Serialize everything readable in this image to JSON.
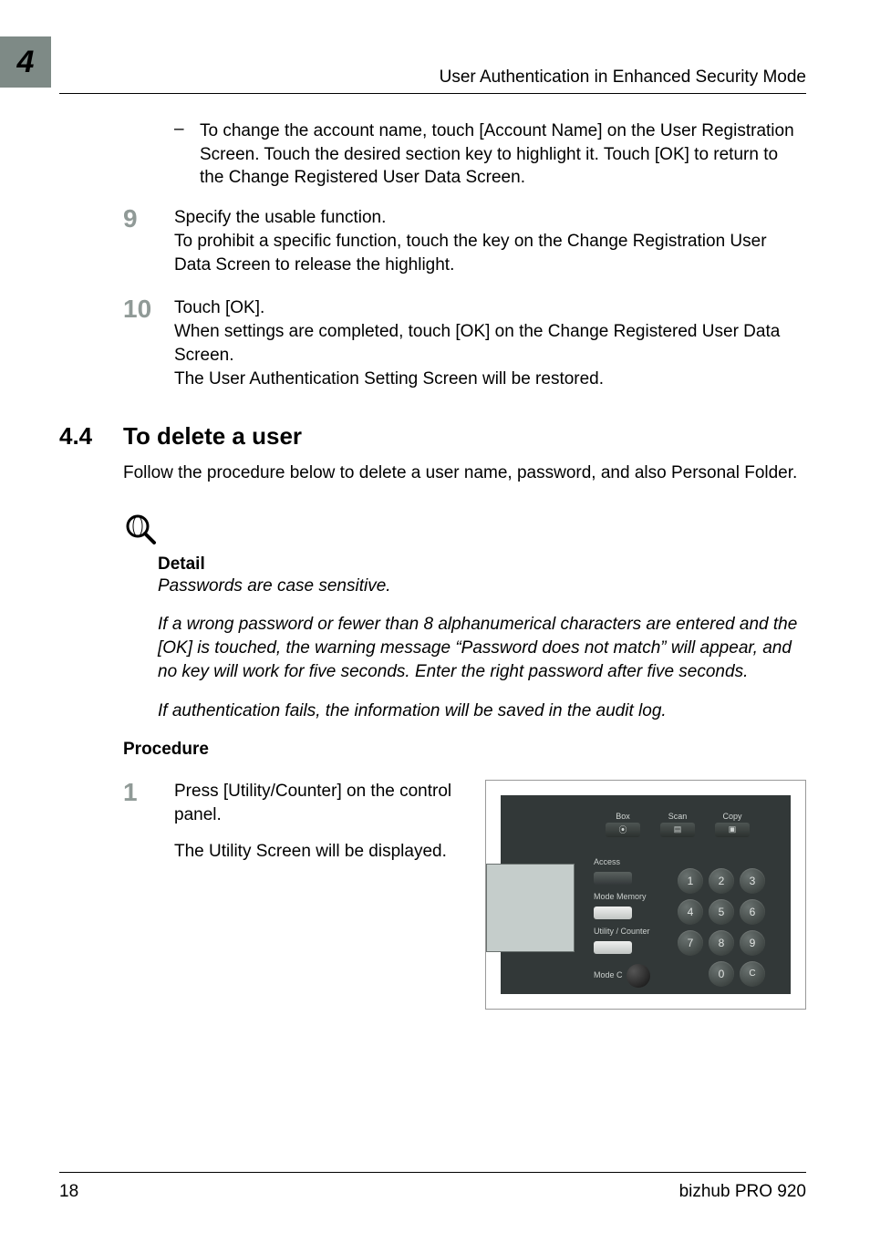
{
  "header": {
    "chapter_number": "4",
    "title": "User Authentication in Enhanced Security Mode"
  },
  "prev_bullet": "To change the account name, touch [Account Name] on the User Registration Screen. Touch the desired section key to highlight it. Touch [OK] to return to the Change Registered User Data Screen.",
  "steps": [
    {
      "num": "9",
      "line1": "Specify the usable function.",
      "line2": "To prohibit a specific function, touch the key on the Change Registration User Data Screen to release the highlight."
    },
    {
      "num": "10",
      "line1": "Touch [OK].",
      "line2": "When settings are completed, touch [OK] on the Change Registered User Data Screen.",
      "line3": "The User Authentication Setting Screen will be restored."
    }
  ],
  "section": {
    "num": "4.4",
    "title": "To delete a user",
    "intro": "Follow the procedure below to delete a user name, password, and also Personal Folder."
  },
  "detail": {
    "label": "Detail",
    "para1": "Passwords are case sensitive.",
    "para2": "If a wrong password or fewer than 8 alphanumerical characters are entered and the [OK] is touched, the warning message “Password does not match” will appear, and no key will work for five seconds. Enter the right password after five seconds.",
    "para3": "If authentication fails, the information will be saved in the audit log."
  },
  "procedure": {
    "label": "Procedure",
    "step_num": "1",
    "p1": "Press [Utility/Counter] on the control panel.",
    "p2": "The Utility Screen will be displayed."
  },
  "panel": {
    "top": {
      "box": "Box",
      "scan": "Scan",
      "copy": "Copy"
    },
    "left": {
      "access": "Access",
      "mode_memory": "Mode Memory",
      "utility_counter": "Utility / Counter",
      "mode_check": "Mode C"
    },
    "keypad": [
      "1",
      "2",
      "3",
      "4",
      "5",
      "6",
      "7",
      "8",
      "9",
      "",
      "0",
      "C"
    ]
  },
  "footer": {
    "page": "18",
    "product": "bizhub PRO 920"
  }
}
